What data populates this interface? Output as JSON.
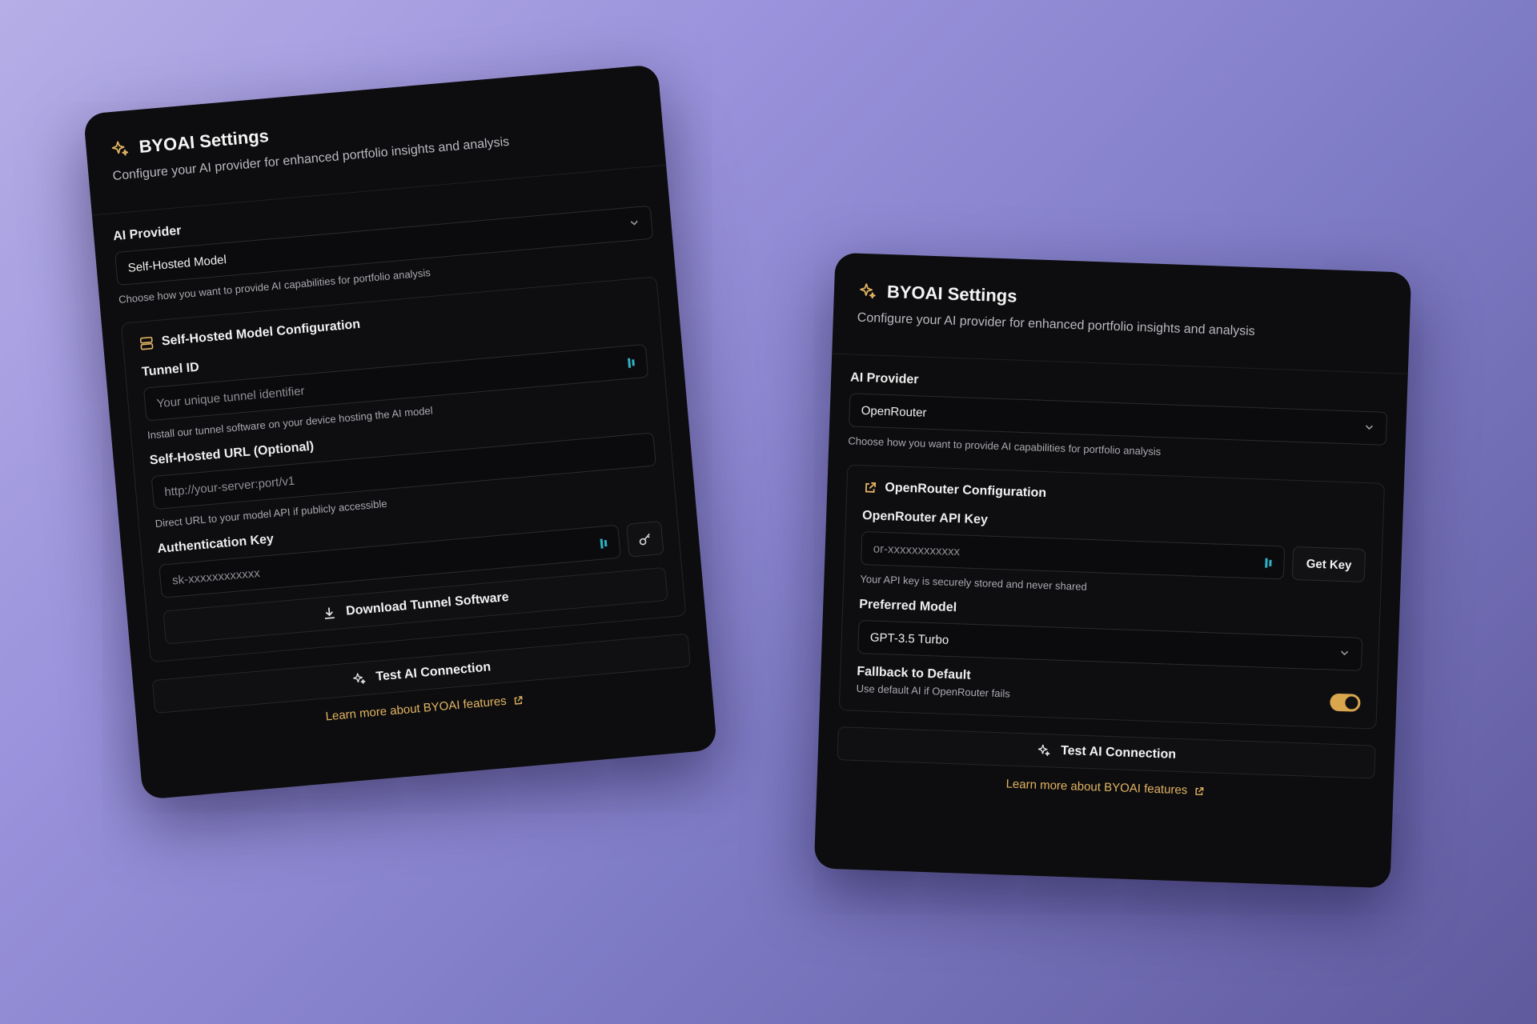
{
  "left_card": {
    "title": "BYOAI Settings",
    "subtitle": "Configure your AI provider for enhanced portfolio insights and analysis",
    "provider_label": "AI Provider",
    "provider_value": "Self-Hosted Model",
    "provider_hint": "Choose how you want to provide AI capabilities for portfolio analysis",
    "section_title": "Self-Hosted Model Configuration",
    "tunnel_label": "Tunnel ID",
    "tunnel_placeholder": "Your unique tunnel identifier",
    "tunnel_hint": "Install our tunnel software on your device hosting the AI model",
    "url_label": "Self-Hosted URL (Optional)",
    "url_placeholder": "http://your-server:port/v1",
    "url_hint": "Direct URL to your model API if publicly accessible",
    "auth_label": "Authentication Key",
    "auth_placeholder": "sk-xxxxxxxxxxxx",
    "download_label": "Download Tunnel Software",
    "test_label": "Test AI Connection",
    "learn_label": "Learn more about BYOAI features"
  },
  "right_card": {
    "title": "BYOAI Settings",
    "subtitle": "Configure your AI provider for enhanced portfolio insights and analysis",
    "provider_label": "AI Provider",
    "provider_value": "OpenRouter",
    "provider_hint": "Choose how you want to provide AI capabilities for portfolio analysis",
    "section_title": "OpenRouter Configuration",
    "api_label": "OpenRouter API Key",
    "api_placeholder": "or-xxxxxxxxxxxx",
    "get_key_label": "Get Key",
    "api_hint": "Your API key is securely stored and never shared",
    "model_label": "Preferred Model",
    "model_value": "GPT-3.5 Turbo",
    "fallback_label": "Fallback to Default",
    "fallback_hint": "Use default AI if OpenRouter fails",
    "fallback_enabled": true,
    "test_label": "Test AI Connection",
    "learn_label": "Learn more about BYOAI features"
  },
  "colors": {
    "accent": "#e2b463",
    "toggle_on": "#d9a64e",
    "card_bg": "#0d0d0f",
    "password_manager_icon": "#2fb3c6"
  },
  "icons": [
    "sparkles-icon",
    "chevron-down-icon",
    "server-icon",
    "password-manager-icon",
    "key-icon",
    "download-icon",
    "external-link-icon"
  ]
}
